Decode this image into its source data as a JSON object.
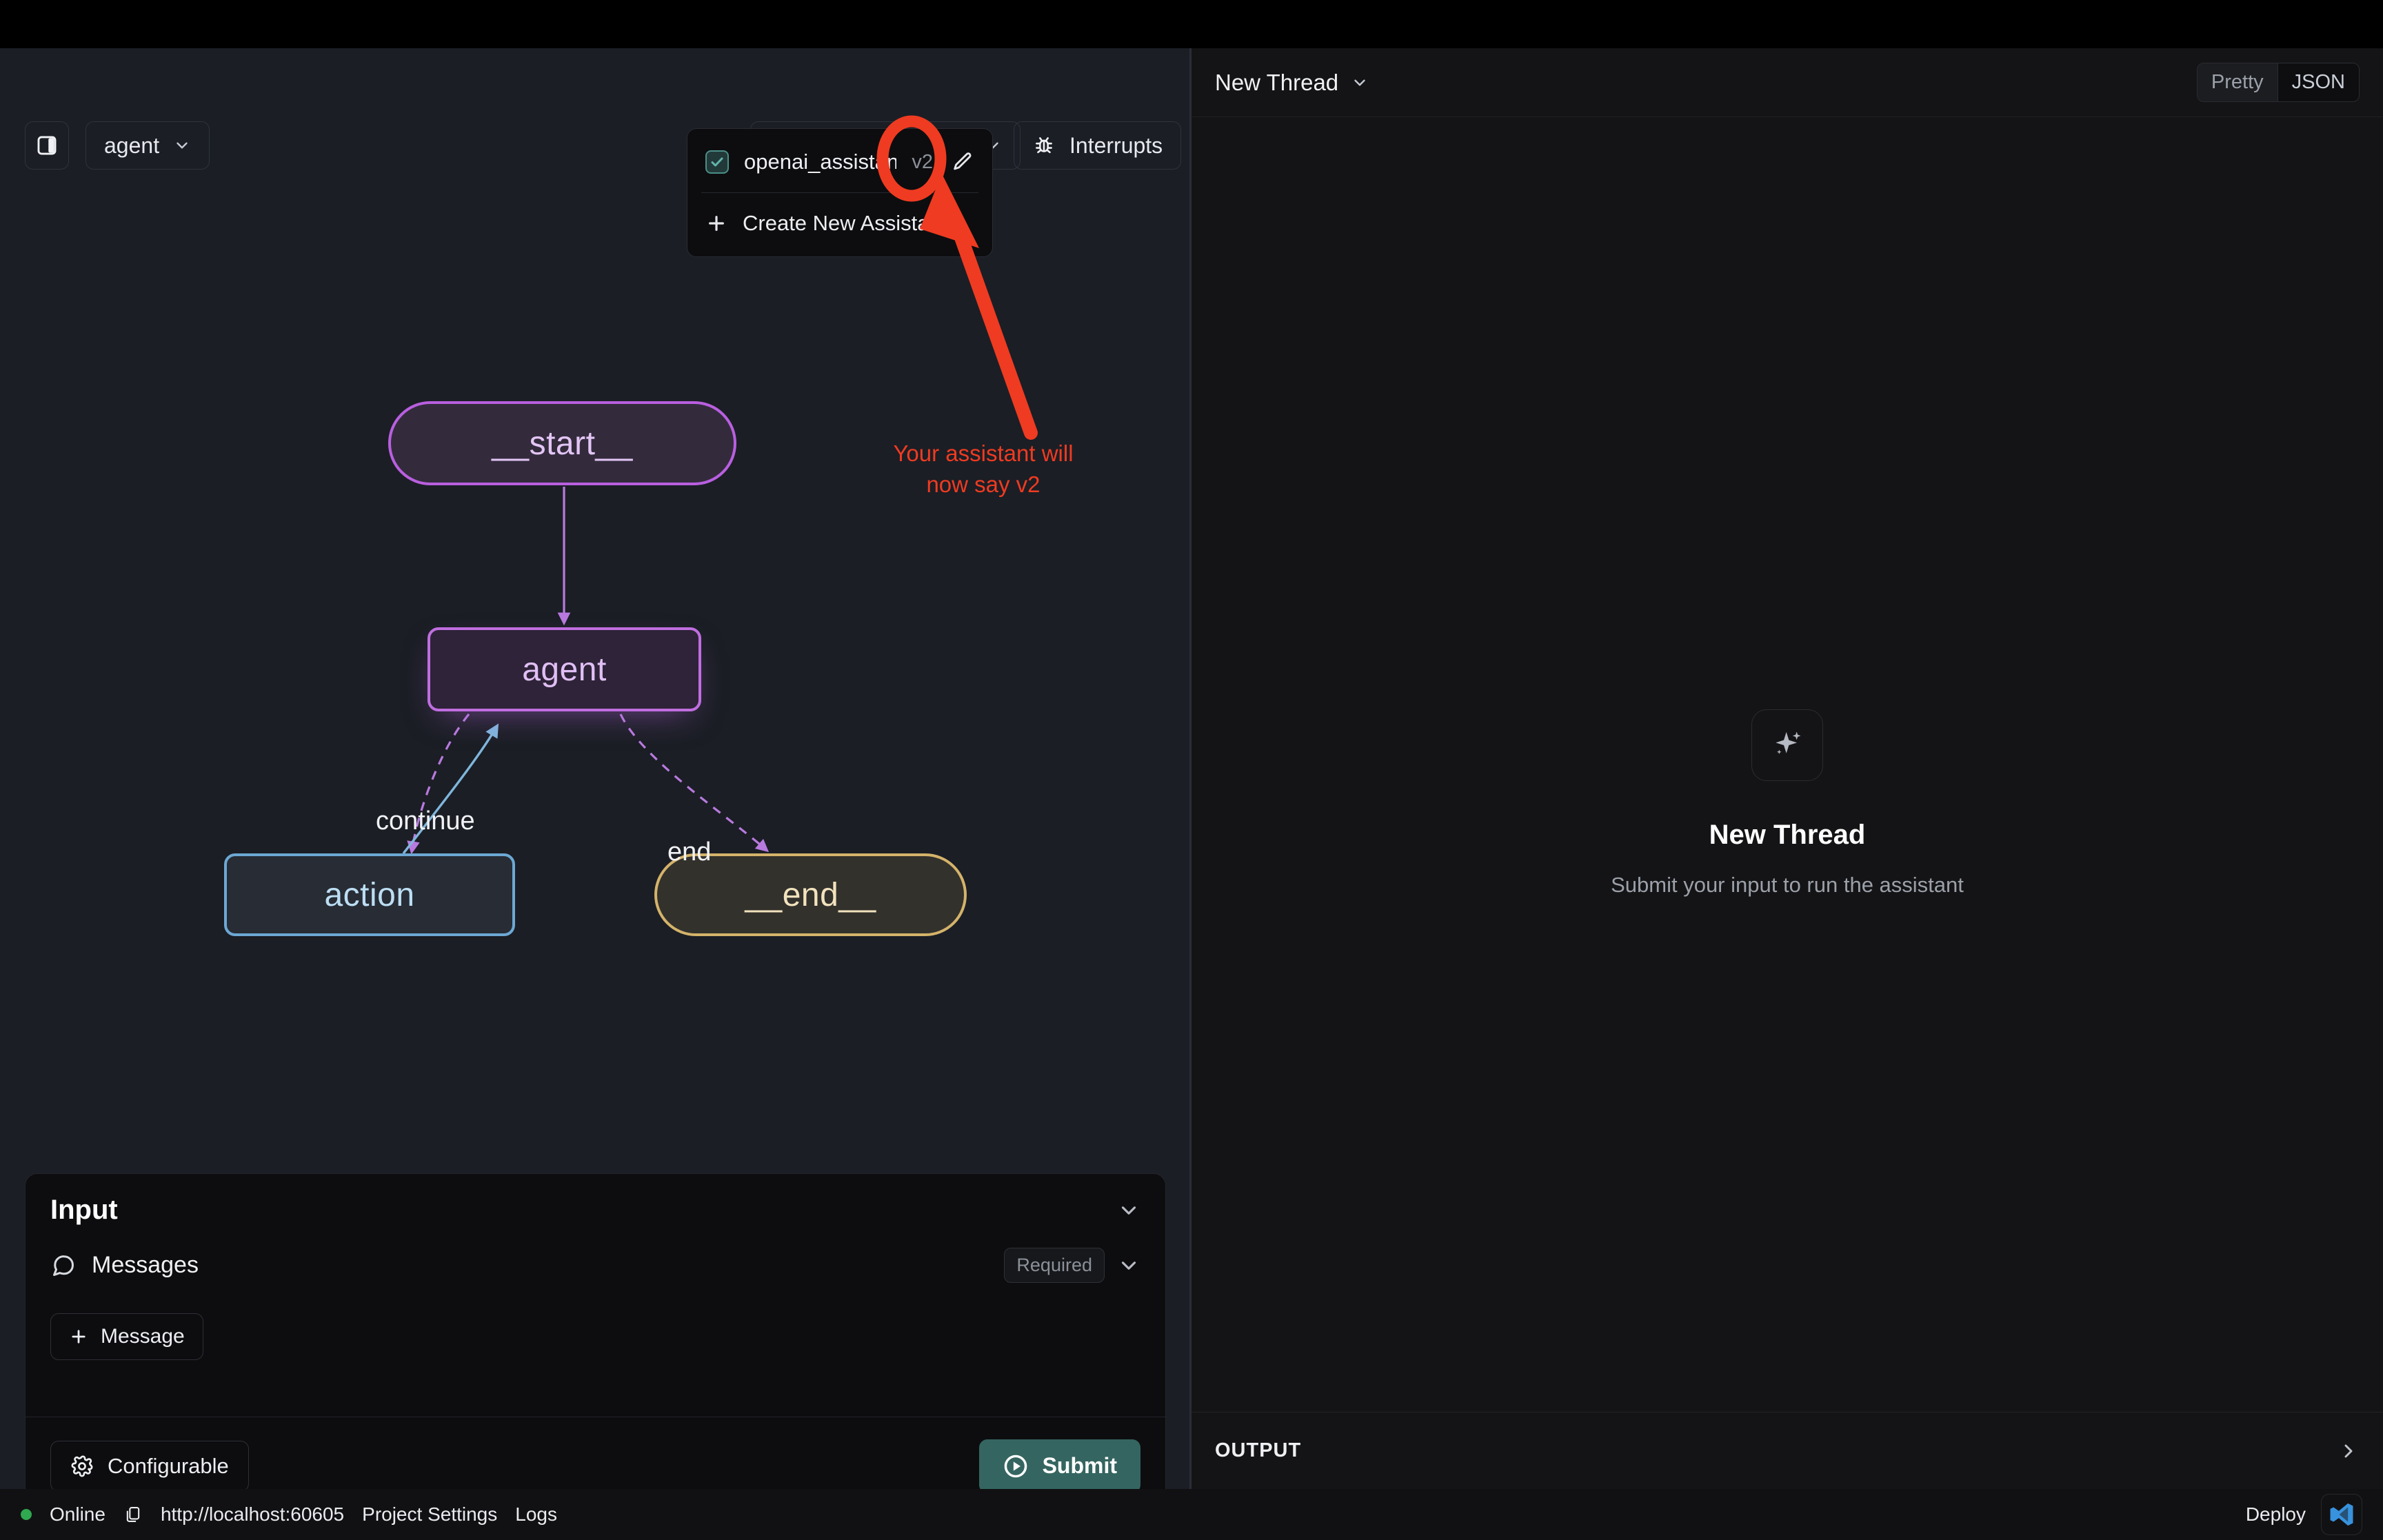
{
  "toolbar": {
    "sidebar_toggle_icon": "panel-left-icon",
    "graph_select_label": "agent",
    "assistant_select_label": "openai_assistant",
    "assistant_select_version": "v2",
    "interrupts_label": "Interrupts",
    "interrupts_icon": "bug-icon"
  },
  "assistant_dropdown": {
    "items": [
      {
        "label": "openai_assistant",
        "version": "v2",
        "checked": true,
        "edit_icon": "pencil-icon"
      }
    ],
    "create_label": "Create New Assistant",
    "create_icon": "plus-icon"
  },
  "annotation": {
    "text_line1": "Your assistant will",
    "text_line2": "now say v2",
    "color": "#ef3b21",
    "highlight_target": "v2",
    "shapes": [
      "ellipse-highlight",
      "arrow"
    ]
  },
  "graph": {
    "nodes": [
      {
        "id": "start",
        "label": "__start__",
        "shape": "pill",
        "color": "#b95fe0"
      },
      {
        "id": "agent",
        "label": "agent",
        "shape": "rect",
        "color": "#c06ee0"
      },
      {
        "id": "action",
        "label": "action",
        "shape": "rect",
        "color": "#6da8d4"
      },
      {
        "id": "end",
        "label": "__end__",
        "shape": "pill",
        "color": "#d4b36a"
      }
    ],
    "edges": [
      {
        "from": "start",
        "to": "agent",
        "label": "",
        "style": "solid"
      },
      {
        "from": "agent",
        "to": "action",
        "label": "continue",
        "style": "dashed"
      },
      {
        "from": "agent",
        "to": "end",
        "label": "end",
        "style": "dashed"
      },
      {
        "from": "action",
        "to": "agent",
        "label": "",
        "style": "solid"
      }
    ]
  },
  "input_panel": {
    "title": "Input",
    "collapse_icon": "chevron-down-icon",
    "field": {
      "name": "Messages",
      "icon": "message-bubble-icon",
      "badge": "Required",
      "chevron_icon": "chevron-down-icon"
    },
    "add_message_label": "Message",
    "add_message_icon": "plus-icon",
    "configurable_label": "Configurable",
    "configurable_icon": "gear-icon",
    "submit_label": "Submit",
    "submit_icon": "play-circle-icon",
    "submit_color": "#356560"
  },
  "thread_panel": {
    "thread_name": "New Thread",
    "thread_chevron_icon": "chevron-down-icon",
    "view_modes": [
      "Pretty",
      "JSON"
    ],
    "active_view_mode": "Pretty",
    "empty_state": {
      "icon": "sparkles-icon",
      "title": "New Thread",
      "subtitle": "Submit your input to run the assistant"
    },
    "output_label": "OUTPUT",
    "output_chevron_icon": "chevron-right-icon"
  },
  "statusbar": {
    "status_label": "Online",
    "status_color": "#2fa84f",
    "url": "http://localhost:60605",
    "copy_icon": "copy-icon",
    "project_settings_label": "Project Settings",
    "logs_label": "Logs",
    "deploy_label": "Deploy",
    "vscode_icon": "vscode-icon"
  }
}
